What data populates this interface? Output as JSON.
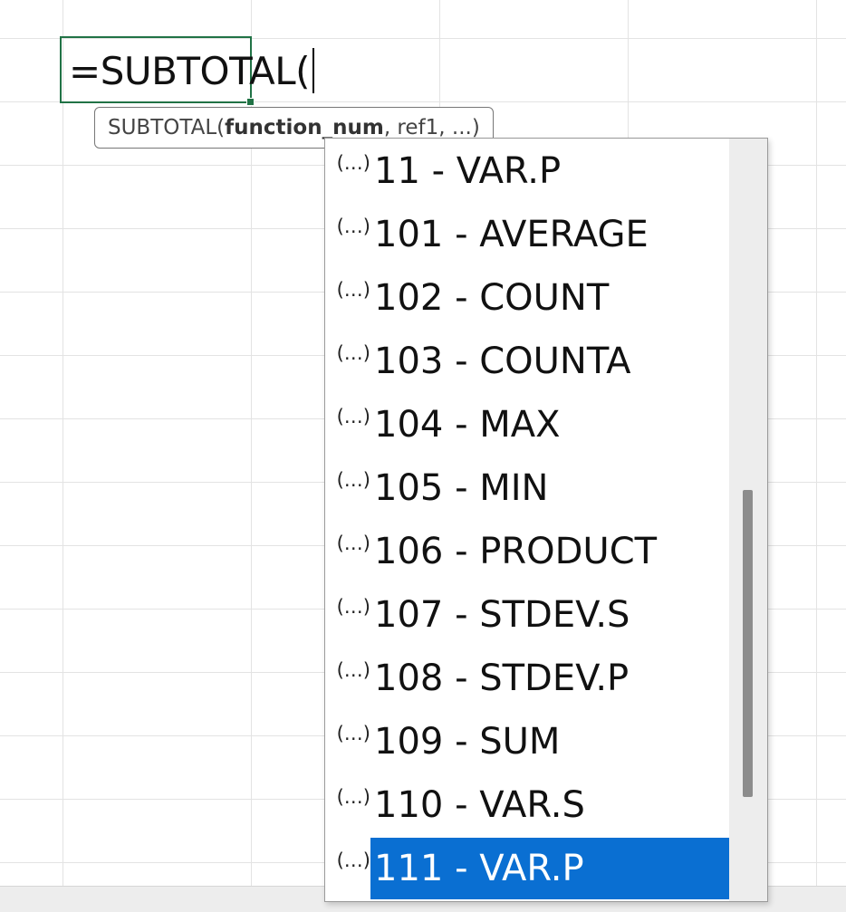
{
  "cell": {
    "formula": "=SUBTOTAL("
  },
  "tooltip": {
    "prefix": "SUBTOTAL(",
    "current_arg": "function_num",
    "rest": ", ref1, ...)"
  },
  "dropdown": {
    "items": [
      {
        "label": "11 - VAR.P",
        "selected": false
      },
      {
        "label": "101 - AVERAGE",
        "selected": false
      },
      {
        "label": "102 - COUNT",
        "selected": false
      },
      {
        "label": "103 - COUNTA",
        "selected": false
      },
      {
        "label": "104 - MAX",
        "selected": false
      },
      {
        "label": "105 - MIN",
        "selected": false
      },
      {
        "label": "106 - PRODUCT",
        "selected": false
      },
      {
        "label": "107 - STDEV.S",
        "selected": false
      },
      {
        "label": "108 - STDEV.P",
        "selected": false
      },
      {
        "label": "109 - SUM",
        "selected": false
      },
      {
        "label": "110 - VAR.S",
        "selected": false
      },
      {
        "label": "111 - VAR.P",
        "selected": true
      }
    ],
    "item_icon": "argument-option-icon",
    "item_glyph": "(…)",
    "scroll_position": 0.46,
    "scroll_visible_fraction": 0.51
  },
  "colors": {
    "selection": "#0a6fd2",
    "active_cell_border": "#217346"
  }
}
